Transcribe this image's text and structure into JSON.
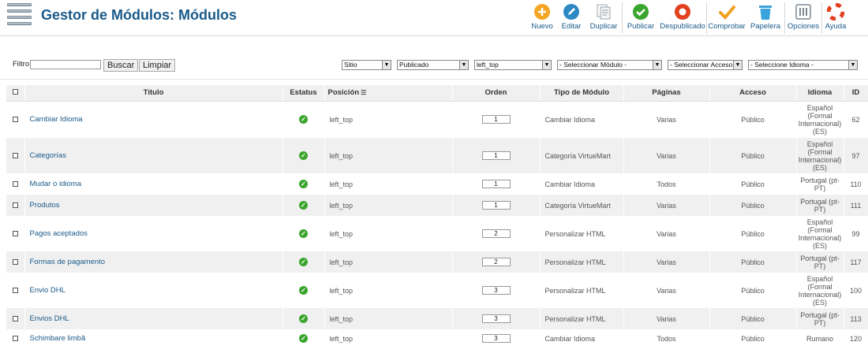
{
  "header": {
    "title": "Gestor de Módulos: Módulos"
  },
  "toolbar": [
    {
      "name": "nuevo-button",
      "icon": "plus-icon",
      "label": "Nuevo",
      "color": "#f5a623",
      "w": 38
    },
    {
      "name": "editar-button",
      "icon": "pencil-icon",
      "label": "Editar",
      "color": "#2d88c4",
      "w": 36
    },
    {
      "name": "duplicar-button",
      "icon": "copy-icon",
      "label": "Duplicar",
      "color": "#9aa5ae",
      "w": 46,
      "sep": true
    },
    {
      "name": "publicar-button",
      "icon": "check-icon",
      "label": "Publicar",
      "color": "#3aa52c",
      "w": 46
    },
    {
      "name": "despublicado-button",
      "icon": "unpublish-icon",
      "label": "Despublicado",
      "color": "#e2401e",
      "w": 60,
      "sep": true
    },
    {
      "name": "comprobar-button",
      "icon": "checkmark-icon",
      "label": "Comprobar",
      "color": "#f0a020",
      "w": 50
    },
    {
      "name": "papelera-button",
      "icon": "trash-icon",
      "label": "Papelera",
      "color": "#3aa3dc",
      "w": 48,
      "sep": true
    },
    {
      "name": "opciones-button",
      "icon": "options-icon",
      "label": "Opciones",
      "color": "#7b8894",
      "w": 46,
      "sep": true
    },
    {
      "name": "ayuda-button",
      "icon": "lifebuoy-icon",
      "label": "Ayuda",
      "color": "#e2401e",
      "w": 34
    }
  ],
  "filter": {
    "label": "Filtro:",
    "value": "",
    "search_label": "Buscar",
    "reset_label": "Limpiar",
    "selects": {
      "site": "Sitio",
      "state": "Publicado",
      "position": "left_top",
      "type": "- Seleccionar Módulo -",
      "access": "- Seleccionar Acceso -",
      "language": "- Seleccione Idioma -"
    }
  },
  "table": {
    "headers": {
      "title": "Título",
      "status": "Estatus",
      "position": "Posición",
      "order": "Orden",
      "type": "Tipo de Módulo",
      "pages": "Páginas",
      "access": "Acceso",
      "language": "Idioma",
      "id": "ID"
    },
    "rows": [
      {
        "title": "Cambiar Idioma",
        "position": "left_top",
        "order": "1",
        "type": "Cambiar Idioma",
        "pages": "Varias",
        "access": "Público",
        "language": "Español (Formal Internacional) (ES)",
        "id": "62"
      },
      {
        "title": "Categorías",
        "position": "left_top",
        "order": "1",
        "type": "Categoría VirtueMart",
        "pages": "Varias",
        "access": "Público",
        "language": "Español (Formal Internacional) (ES)",
        "id": "97"
      },
      {
        "title": "Mudar o idioma",
        "position": "left_top",
        "order": "1",
        "type": "Cambiar Idioma",
        "pages": "Todos",
        "access": "Público",
        "language": "Portugal (pt-PT)",
        "id": "110"
      },
      {
        "title": "Produtos",
        "position": "left_top",
        "order": "1",
        "type": "Categoría VirtueMart",
        "pages": "Varias",
        "access": "Público",
        "language": "Portugal (pt-PT)",
        "id": "111"
      },
      {
        "title": "Pagos aceptados",
        "position": "left_top",
        "order": "2",
        "type": "Personalizar HTML",
        "pages": "Varias",
        "access": "Público",
        "language": "Español (Formal Internacional) (ES)",
        "id": "99"
      },
      {
        "title": "Formas de pagamento",
        "position": "left_top",
        "order": "2",
        "type": "Personalizar HTML",
        "pages": "Varias",
        "access": "Público",
        "language": "Portugal (pt-PT)",
        "id": "117"
      },
      {
        "title": "Envio DHL",
        "position": "left_top",
        "order": "3",
        "type": "Personalizar HTML",
        "pages": "Varias",
        "access": "Público",
        "language": "Español (Formal Internacional) (ES)",
        "id": "100"
      },
      {
        "title": "Envios DHL",
        "position": "left_top",
        "order": "3",
        "type": "Personalizar HTML",
        "pages": "Varias",
        "access": "Público",
        "language": "Portugal (pt-PT)",
        "id": "113"
      },
      {
        "title": "Schimbare limbă",
        "position": "left_top",
        "order": "3",
        "type": "Cambiar Idioma",
        "pages": "Todos",
        "access": "Público",
        "language": "Rumano",
        "id": "120"
      }
    ]
  }
}
